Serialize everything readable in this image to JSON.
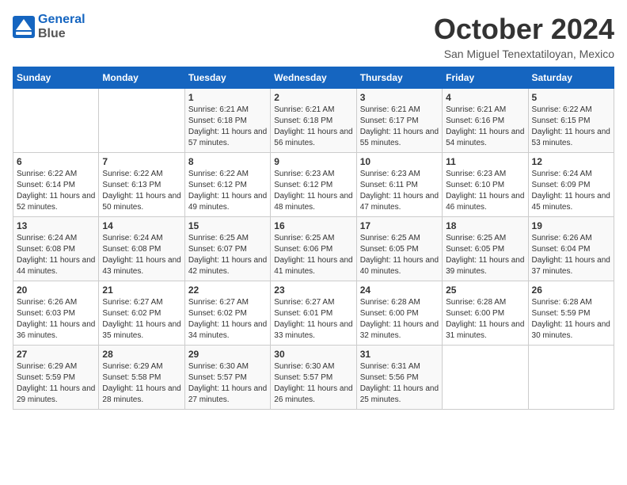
{
  "header": {
    "logo_line1": "General",
    "logo_line2": "Blue",
    "month": "October 2024",
    "location": "San Miguel Tenextatiloyan, Mexico"
  },
  "days_of_week": [
    "Sunday",
    "Monday",
    "Tuesday",
    "Wednesday",
    "Thursday",
    "Friday",
    "Saturday"
  ],
  "weeks": [
    [
      {
        "day": "",
        "sunrise": "",
        "sunset": "",
        "daylight": ""
      },
      {
        "day": "",
        "sunrise": "",
        "sunset": "",
        "daylight": ""
      },
      {
        "day": "1",
        "sunrise": "Sunrise: 6:21 AM",
        "sunset": "Sunset: 6:18 PM",
        "daylight": "Daylight: 11 hours and 57 minutes."
      },
      {
        "day": "2",
        "sunrise": "Sunrise: 6:21 AM",
        "sunset": "Sunset: 6:18 PM",
        "daylight": "Daylight: 11 hours and 56 minutes."
      },
      {
        "day": "3",
        "sunrise": "Sunrise: 6:21 AM",
        "sunset": "Sunset: 6:17 PM",
        "daylight": "Daylight: 11 hours and 55 minutes."
      },
      {
        "day": "4",
        "sunrise": "Sunrise: 6:21 AM",
        "sunset": "Sunset: 6:16 PM",
        "daylight": "Daylight: 11 hours and 54 minutes."
      },
      {
        "day": "5",
        "sunrise": "Sunrise: 6:22 AM",
        "sunset": "Sunset: 6:15 PM",
        "daylight": "Daylight: 11 hours and 53 minutes."
      }
    ],
    [
      {
        "day": "6",
        "sunrise": "Sunrise: 6:22 AM",
        "sunset": "Sunset: 6:14 PM",
        "daylight": "Daylight: 11 hours and 52 minutes."
      },
      {
        "day": "7",
        "sunrise": "Sunrise: 6:22 AM",
        "sunset": "Sunset: 6:13 PM",
        "daylight": "Daylight: 11 hours and 50 minutes."
      },
      {
        "day": "8",
        "sunrise": "Sunrise: 6:22 AM",
        "sunset": "Sunset: 6:12 PM",
        "daylight": "Daylight: 11 hours and 49 minutes."
      },
      {
        "day": "9",
        "sunrise": "Sunrise: 6:23 AM",
        "sunset": "Sunset: 6:12 PM",
        "daylight": "Daylight: 11 hours and 48 minutes."
      },
      {
        "day": "10",
        "sunrise": "Sunrise: 6:23 AM",
        "sunset": "Sunset: 6:11 PM",
        "daylight": "Daylight: 11 hours and 47 minutes."
      },
      {
        "day": "11",
        "sunrise": "Sunrise: 6:23 AM",
        "sunset": "Sunset: 6:10 PM",
        "daylight": "Daylight: 11 hours and 46 minutes."
      },
      {
        "day": "12",
        "sunrise": "Sunrise: 6:24 AM",
        "sunset": "Sunset: 6:09 PM",
        "daylight": "Daylight: 11 hours and 45 minutes."
      }
    ],
    [
      {
        "day": "13",
        "sunrise": "Sunrise: 6:24 AM",
        "sunset": "Sunset: 6:08 PM",
        "daylight": "Daylight: 11 hours and 44 minutes."
      },
      {
        "day": "14",
        "sunrise": "Sunrise: 6:24 AM",
        "sunset": "Sunset: 6:08 PM",
        "daylight": "Daylight: 11 hours and 43 minutes."
      },
      {
        "day": "15",
        "sunrise": "Sunrise: 6:25 AM",
        "sunset": "Sunset: 6:07 PM",
        "daylight": "Daylight: 11 hours and 42 minutes."
      },
      {
        "day": "16",
        "sunrise": "Sunrise: 6:25 AM",
        "sunset": "Sunset: 6:06 PM",
        "daylight": "Daylight: 11 hours and 41 minutes."
      },
      {
        "day": "17",
        "sunrise": "Sunrise: 6:25 AM",
        "sunset": "Sunset: 6:05 PM",
        "daylight": "Daylight: 11 hours and 40 minutes."
      },
      {
        "day": "18",
        "sunrise": "Sunrise: 6:25 AM",
        "sunset": "Sunset: 6:05 PM",
        "daylight": "Daylight: 11 hours and 39 minutes."
      },
      {
        "day": "19",
        "sunrise": "Sunrise: 6:26 AM",
        "sunset": "Sunset: 6:04 PM",
        "daylight": "Daylight: 11 hours and 37 minutes."
      }
    ],
    [
      {
        "day": "20",
        "sunrise": "Sunrise: 6:26 AM",
        "sunset": "Sunset: 6:03 PM",
        "daylight": "Daylight: 11 hours and 36 minutes."
      },
      {
        "day": "21",
        "sunrise": "Sunrise: 6:27 AM",
        "sunset": "Sunset: 6:02 PM",
        "daylight": "Daylight: 11 hours and 35 minutes."
      },
      {
        "day": "22",
        "sunrise": "Sunrise: 6:27 AM",
        "sunset": "Sunset: 6:02 PM",
        "daylight": "Daylight: 11 hours and 34 minutes."
      },
      {
        "day": "23",
        "sunrise": "Sunrise: 6:27 AM",
        "sunset": "Sunset: 6:01 PM",
        "daylight": "Daylight: 11 hours and 33 minutes."
      },
      {
        "day": "24",
        "sunrise": "Sunrise: 6:28 AM",
        "sunset": "Sunset: 6:00 PM",
        "daylight": "Daylight: 11 hours and 32 minutes."
      },
      {
        "day": "25",
        "sunrise": "Sunrise: 6:28 AM",
        "sunset": "Sunset: 6:00 PM",
        "daylight": "Daylight: 11 hours and 31 minutes."
      },
      {
        "day": "26",
        "sunrise": "Sunrise: 6:28 AM",
        "sunset": "Sunset: 5:59 PM",
        "daylight": "Daylight: 11 hours and 30 minutes."
      }
    ],
    [
      {
        "day": "27",
        "sunrise": "Sunrise: 6:29 AM",
        "sunset": "Sunset: 5:59 PM",
        "daylight": "Daylight: 11 hours and 29 minutes."
      },
      {
        "day": "28",
        "sunrise": "Sunrise: 6:29 AM",
        "sunset": "Sunset: 5:58 PM",
        "daylight": "Daylight: 11 hours and 28 minutes."
      },
      {
        "day": "29",
        "sunrise": "Sunrise: 6:30 AM",
        "sunset": "Sunset: 5:57 PM",
        "daylight": "Daylight: 11 hours and 27 minutes."
      },
      {
        "day": "30",
        "sunrise": "Sunrise: 6:30 AM",
        "sunset": "Sunset: 5:57 PM",
        "daylight": "Daylight: 11 hours and 26 minutes."
      },
      {
        "day": "31",
        "sunrise": "Sunrise: 6:31 AM",
        "sunset": "Sunset: 5:56 PM",
        "daylight": "Daylight: 11 hours and 25 minutes."
      },
      {
        "day": "",
        "sunrise": "",
        "sunset": "",
        "daylight": ""
      },
      {
        "day": "",
        "sunrise": "",
        "sunset": "",
        "daylight": ""
      }
    ]
  ]
}
